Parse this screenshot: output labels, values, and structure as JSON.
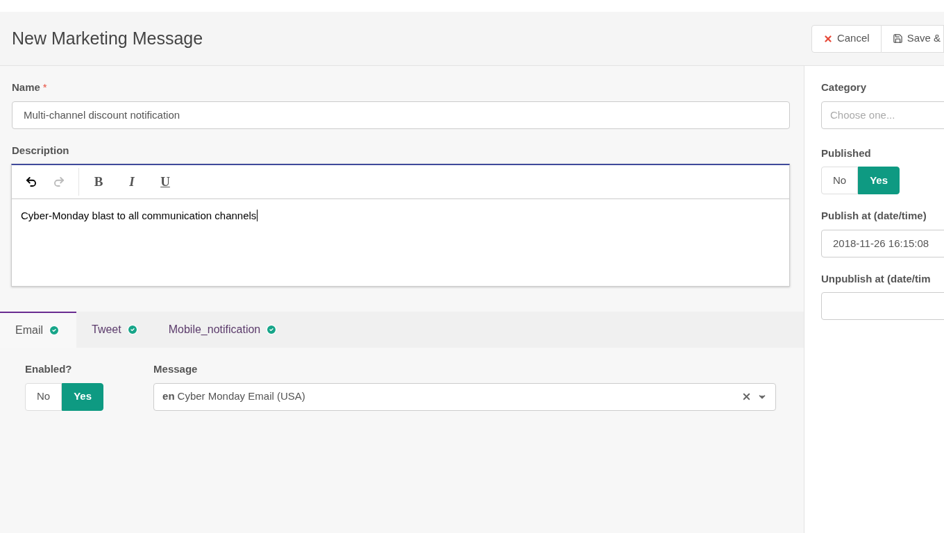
{
  "header": {
    "title": "New Marketing Message",
    "buttons": [
      {
        "kind": "cancel",
        "label": "Cancel"
      },
      {
        "kind": "save",
        "label": "Save &"
      }
    ]
  },
  "name_field": {
    "label": "Name",
    "required_mark": "*",
    "value": "Multi-channel discount notification"
  },
  "description": {
    "label": "Description",
    "toolbar": [
      {
        "kind": "undo",
        "disabled": false
      },
      {
        "kind": "redo",
        "disabled": true
      },
      {
        "kind": "bold",
        "label": "B"
      },
      {
        "kind": "italic",
        "label": "I"
      },
      {
        "kind": "underline",
        "label": "U"
      }
    ],
    "text": "Cyber-Monday blast to all communication channels"
  },
  "tabs": [
    {
      "label": "Email",
      "selected": true,
      "valid": true
    },
    {
      "label": "Tweet",
      "selected": false,
      "valid": true
    },
    {
      "label": "Mobile_notification",
      "selected": false,
      "valid": true
    }
  ],
  "tab_panel": {
    "enabled": {
      "label": "Enabled?",
      "options": [
        {
          "label": "No",
          "selected": false
        },
        {
          "label": "Yes",
          "selected": true
        }
      ]
    },
    "message": {
      "label": "Message",
      "lang": "en",
      "value": "Cyber Monday Email (USA)"
    }
  },
  "sidebar": {
    "category": {
      "label": "Category",
      "placeholder": "Choose one..."
    },
    "published": {
      "label": "Published",
      "options": [
        {
          "label": "No",
          "selected": false
        },
        {
          "label": "Yes",
          "selected": true
        }
      ]
    },
    "publish_at": {
      "label": "Publish at (date/time)",
      "value": "2018-11-26 16:15:08"
    },
    "unpublish_at": {
      "label": "Unpublish at (date/tim"
    }
  }
}
